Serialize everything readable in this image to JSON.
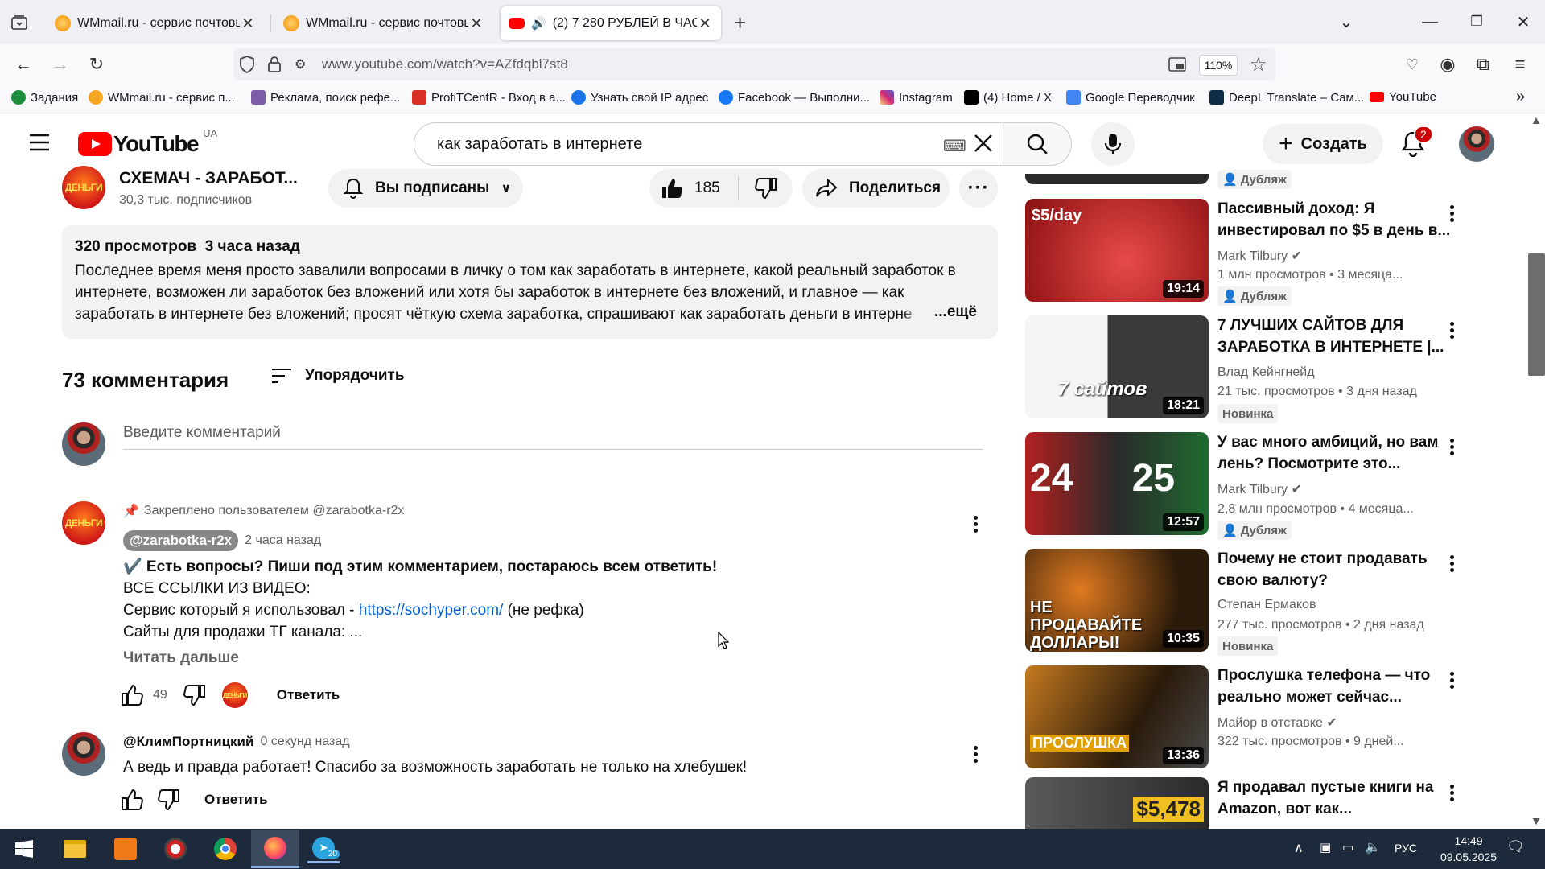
{
  "browser": {
    "tabs": [
      {
        "title": "WMmail.ru - сервис почтовых"
      },
      {
        "title": "WMmail.ru - сервис почтовых"
      },
      {
        "title": "(2) 7 280 РУБЛЕЙ В ЧАС ="
      }
    ],
    "url": "www.youtube.com/watch?v=AZfdqbl7st8",
    "zoom": "110%",
    "bookmarks": [
      {
        "label": "Задания",
        "color": "#1e8e3e"
      },
      {
        "label": "WMmail.ru - сервис п...",
        "color": "#f5a623"
      },
      {
        "label": "Реклама, поиск рефе...",
        "color": "#7b5ea7"
      },
      {
        "label": "ProfiTCentR - Вход в а...",
        "color": "#d93025"
      },
      {
        "label": "Узнать свой IP адрес",
        "color": "#1a73e8"
      },
      {
        "label": "Facebook — Выполни...",
        "color": "#1877f2"
      },
      {
        "label": "Instagram",
        "color": "#d6249f"
      },
      {
        "label": "(4) Home / X",
        "color": "#000000"
      },
      {
        "label": "Google Переводчик",
        "color": "#4285f4"
      },
      {
        "label": "DeepL Translate – Сам...",
        "color": "#0f2b46"
      },
      {
        "label": "YouTube",
        "color": "#ff0000"
      }
    ]
  },
  "youtube": {
    "logo_text": "YouTube",
    "region": "UA",
    "search_query": "как заработать в интернете",
    "create_label": "Создать",
    "notifications": "2"
  },
  "channel": {
    "avatar_text": "ДЕНЬГИ",
    "name": "СХЕМАЧ - ЗАРАБОТ...",
    "subscribers": "30,3 тыс. подписчиков",
    "subscribed_label": "Вы подписаны",
    "likes": "185",
    "share_label": "Поделиться"
  },
  "description": {
    "views": "320 просмотров",
    "date": "3 часа назад",
    "text": "Последнее время меня просто завалили вопросами в личку о том как заработать в интернете, какой реальный заработок в интернете, возможен ли заработок без вложений или хотя бы заработок в интернете без вложений, и главное — как заработать в интернете без вложений; просят чёткую схема заработка, спрашивают как заработать деньги в интерне",
    "more": "...ещё"
  },
  "comments": {
    "count_label": "73 комментария",
    "sort_label": "Упорядочить",
    "input_placeholder": "Введите комментарий",
    "pinned": {
      "pinned_label": "Закреплено пользователем @zarabotka-r2x",
      "author": "@zarabotka-r2x",
      "time": "2 часа назад",
      "line1": "✔️ Есть вопросы? Пиши под этим комментарием, постараюсь всем ответить!",
      "line2": "ВСЕ ССЫЛКИ ИЗ ВИДЕО:",
      "line3_prefix": "Сервис который я использовал - ",
      "line3_link": "https://sochyper.com/",
      "line3_suffix": " (не рефка)",
      "line4": "Сайты для продажи ТГ канала: ...",
      "read_more": "Читать дальше",
      "likes": "49",
      "reply": "Ответить"
    },
    "second": {
      "author": "@КлимПортницкий",
      "time": "0 секунд назад",
      "text": "А ведь и правда работает! Спасибо за возможность заработать не только на хлебушек!",
      "reply": "Ответить"
    }
  },
  "sidebar": {
    "top_badge": "Дубляж",
    "videos": [
      {
        "title": "Пассивный доход: Я инвестировал по $5 в день в...",
        "channel": "Mark Tilbury",
        "verified": true,
        "views": "1 млн просмотров",
        "age": "3 месяца...",
        "duration": "19:14",
        "badge": "Дубляж",
        "thumb_text": "$5/day",
        "thumb_bg": "#c41e1e"
      },
      {
        "title": "7 ЛУЧШИХ САЙТОВ ДЛЯ ЗАРАБОТКА В ИНТЕРНЕТЕ |...",
        "channel": "Влад Кейнгнейд",
        "verified": false,
        "views": "21 тыс. просмотров",
        "age": "3 дня назад",
        "duration": "18:21",
        "badge": "Новинка",
        "thumb_text": "7 сайтов",
        "thumb_bg": "#2b2b2b"
      },
      {
        "title": "У вас много амбиций, но вам лень? Посмотрите это...",
        "channel": "Mark Tilbury",
        "verified": true,
        "views": "2,8 млн просмотров",
        "age": "4 месяца...",
        "duration": "12:57",
        "badge": "Дубляж",
        "thumb_text": "24 25",
        "thumb_bg": "#8e1b1b"
      },
      {
        "title": "Почему не стоит продавать свою валюту?",
        "channel": "Степан Ермаков",
        "verified": false,
        "views": "277 тыс. просмотров",
        "age": "2 дня назад",
        "duration": "10:35",
        "badge": "Новинка",
        "thumb_text": "НЕ ПРОДАВАЙТЕ ДОЛЛАРЫ!",
        "thumb_bg": "#3a2a1a"
      },
      {
        "title": "Прослушка телефона — что реально может сейчас...",
        "channel": "Майор в отставке",
        "verified": true,
        "views": "322 тыс. просмотров",
        "age": "9 дней...",
        "duration": "13:36",
        "badge": "",
        "thumb_text": "ПРОСЛУШКА",
        "thumb_bg": "#5a3a1a"
      },
      {
        "title": "Я продавал пустые книги на Amazon, вот как...",
        "channel": "",
        "verified": false,
        "views": "",
        "age": "",
        "duration": "",
        "badge": "",
        "thumb_text": "$5,478",
        "thumb_bg": "#3a3a3a"
      }
    ]
  },
  "taskbar": {
    "language": "РУС",
    "time": "14:49",
    "date": "09.05.2025",
    "telegram_badge": "20"
  }
}
